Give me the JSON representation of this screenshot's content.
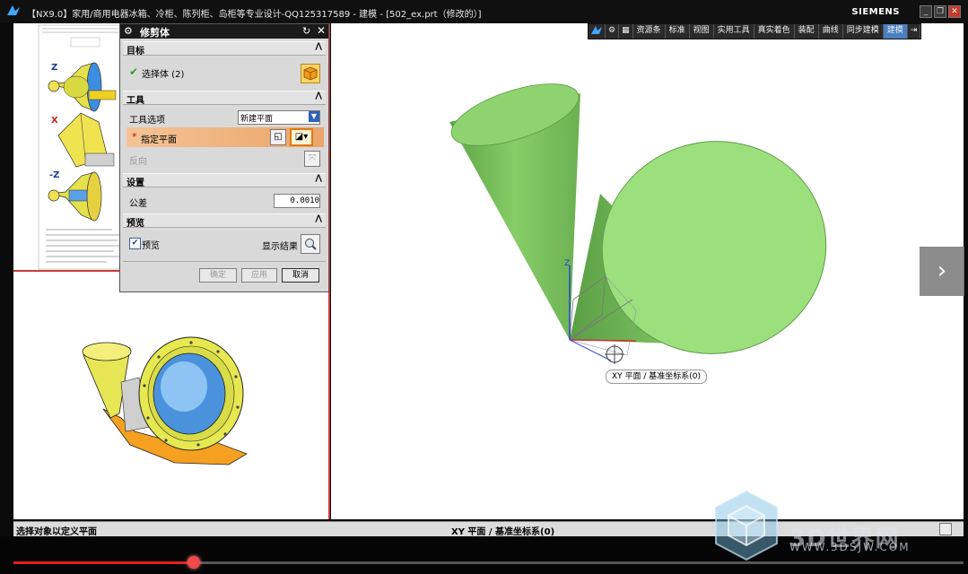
{
  "window": {
    "title": "【NX9.0】家用/商用电器冰箱、冷柜、陈列柜、岛柜等专业设计-QQ125317589 - 建模 - [502_ex.prt（修改的）]",
    "brand": "SIEMENS"
  },
  "toolbar": {
    "items": [
      "资源条",
      "标准",
      "视图",
      "实用工具",
      "真实着色",
      "装配",
      "曲线",
      "同步建模",
      "建模"
    ],
    "active": "建模"
  },
  "dialog": {
    "title": "修剪体",
    "sections": {
      "target": {
        "header": "目标",
        "select_label": "选择体 (2)"
      },
      "tool": {
        "header": "工具",
        "option_label": "工具选项",
        "option_value": "新建平面",
        "plane_label": "指定平面",
        "reverse_label": "反向"
      },
      "settings": {
        "header": "设置",
        "tolerance_label": "公差",
        "tolerance_value": "0.0010"
      },
      "preview": {
        "header": "预览",
        "preview_label": "预览",
        "preview_checked": true,
        "show_result_label": "显示结果"
      }
    },
    "buttons": {
      "ok": "确定",
      "apply": "应用",
      "cancel": "取消"
    }
  },
  "viewport": {
    "tooltip": "XY 平面 / 基准坐标系(0)",
    "axis_label": "Z"
  },
  "thumbnail": {
    "labels": [
      "Z",
      "X",
      "-Z"
    ]
  },
  "statusbar": {
    "prompt": "选择对象以定义平面",
    "selection": "XY 平面 / 基准坐标系(0)"
  },
  "video": {
    "progress": 0.19
  },
  "watermark": {
    "text": "3D世界网",
    "url": "WWW.3DSJW.COM"
  },
  "colors": {
    "cone_dark": "#6fb552",
    "cone_light": "#9fe283",
    "accent_red": "#c63b3b",
    "highlight_orange": "#f0b070"
  }
}
